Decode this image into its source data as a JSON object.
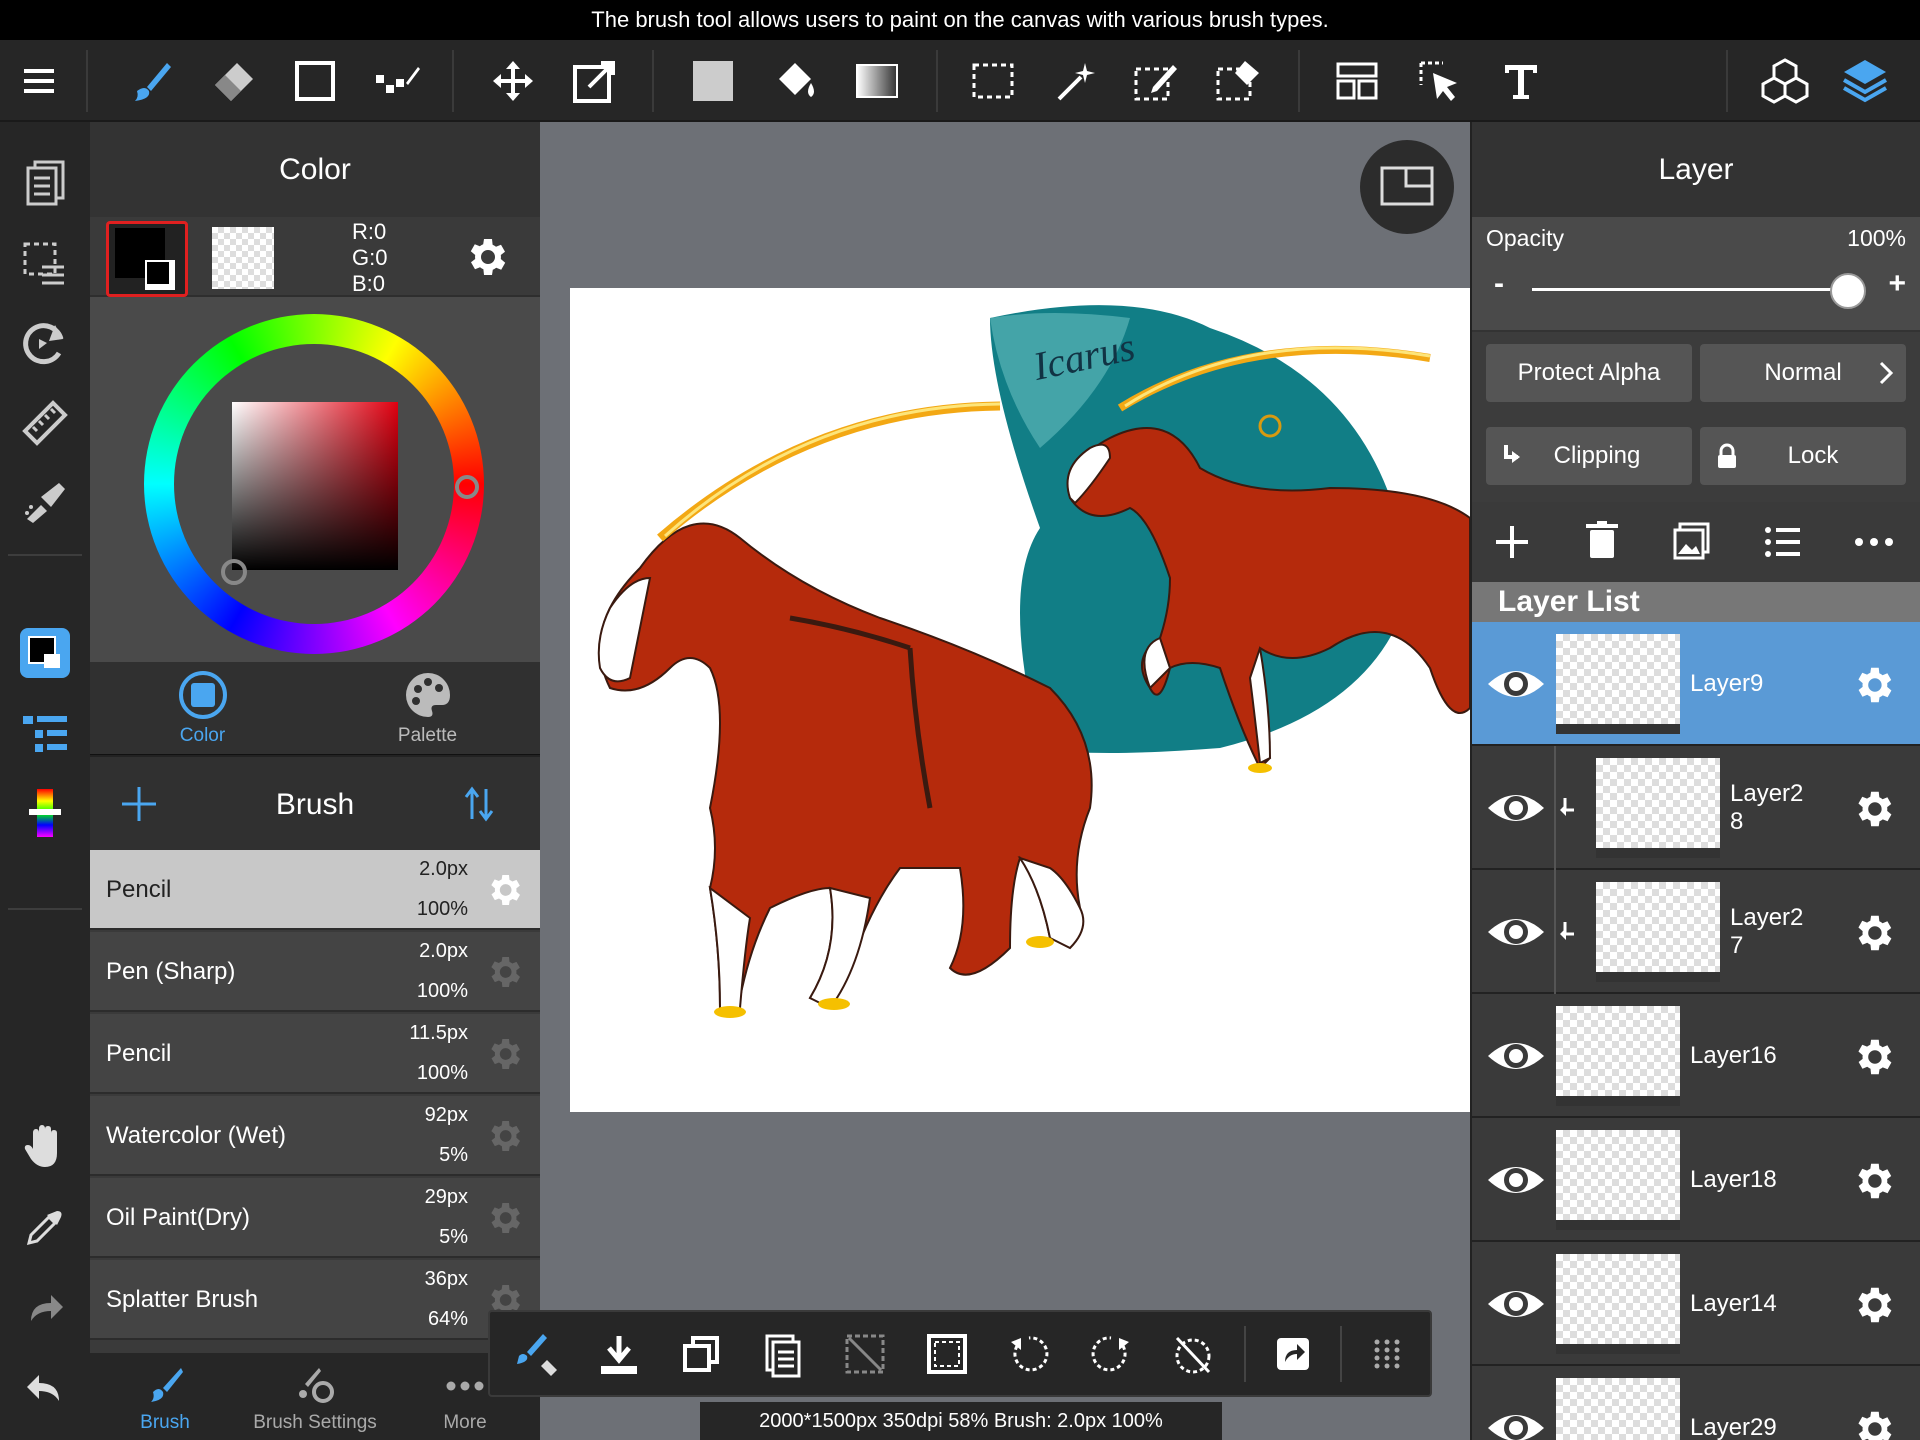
{
  "caption": "The brush tool allows users to paint on the canvas with various brush types.",
  "colors": {
    "accent": "#4aa6f0",
    "selected_layer": "#5a9ad6",
    "panel_dark": "#262626",
    "teal": "#117e86",
    "horse": "#b52a0c"
  },
  "toolbar": {
    "icons": [
      "menu-icon",
      "brush-icon",
      "eraser-icon",
      "rectangle-icon",
      "dot-pen-icon",
      "move-icon",
      "transform-icon",
      "fill-color-icon",
      "bucket-icon",
      "gradient-icon",
      "select-rect-icon",
      "magic-wand-icon",
      "select-pen-icon",
      "select-eraser-icon",
      "layout-icon",
      "select-layer-icon",
      "text-icon",
      "materials-icon",
      "layers-icon"
    ]
  },
  "color_panel": {
    "title": "Color",
    "rgb": {
      "r": "R:0",
      "g": "G:0",
      "b": "B:0"
    },
    "tabs": {
      "color": "Color",
      "palette": "Palette"
    }
  },
  "brush_panel": {
    "title": "Brush",
    "items": [
      {
        "name": "Pencil",
        "size": "2.0px",
        "opacity": "100%"
      },
      {
        "name": "Pen (Sharp)",
        "size": "2.0px",
        "opacity": "100%"
      },
      {
        "name": "Pencil",
        "size": "11.5px",
        "opacity": "100%"
      },
      {
        "name": "Watercolor (Wet)",
        "size": "92px",
        "opacity": "5%"
      },
      {
        "name": "Oil Paint(Dry)",
        "size": "29px",
        "opacity": "5%"
      },
      {
        "name": "Splatter Brush",
        "size": "36px",
        "opacity": "64%"
      }
    ],
    "tabs": {
      "brush": "Brush",
      "settings": "Brush Settings",
      "more": "More"
    }
  },
  "canvas": {
    "artwork_label": "Icarus"
  },
  "status": "2000*1500px 350dpi 58% Brush: 2.0px 100%",
  "layer_panel": {
    "title": "Layer",
    "opacity_label": "Opacity",
    "opacity_value": "100%",
    "opacity_fraction": 1.0,
    "minus": "-",
    "plus": "+",
    "protect_alpha": "Protect Alpha",
    "blend_mode": "Normal",
    "clipping": "Clipping",
    "lock": "Lock",
    "list_title": "Layer List",
    "layers": [
      {
        "name": "Layer9",
        "selected": true,
        "clipped": false
      },
      {
        "name": "Layer2\n8",
        "selected": false,
        "clipped": true
      },
      {
        "name": "Layer2\n7",
        "selected": false,
        "clipped": true
      },
      {
        "name": "Layer16",
        "selected": false,
        "clipped": false
      },
      {
        "name": "Layer18",
        "selected": false,
        "clipped": false
      },
      {
        "name": "Layer14",
        "selected": false,
        "clipped": false
      },
      {
        "name": "Layer29",
        "selected": false,
        "clipped": false
      }
    ]
  }
}
